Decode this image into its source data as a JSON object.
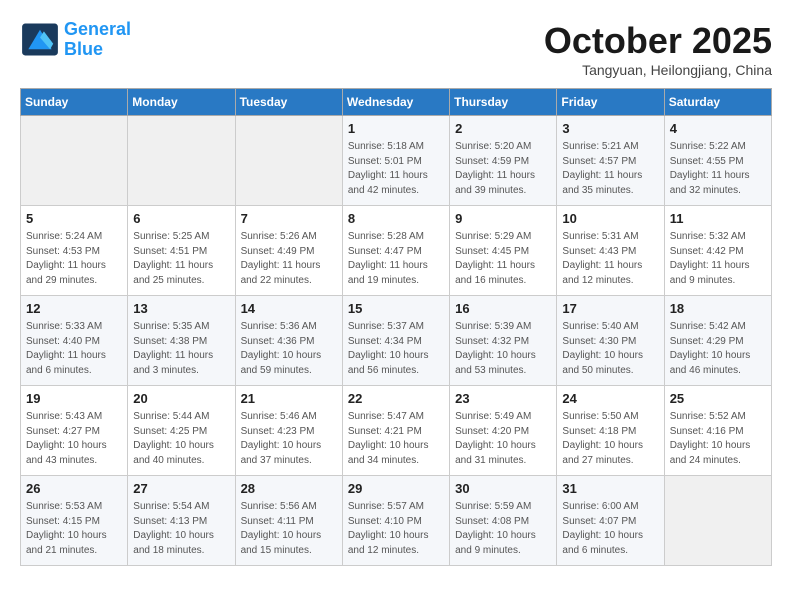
{
  "header": {
    "logo_line1": "General",
    "logo_line2": "Blue",
    "month_title": "October 2025",
    "location": "Tangyuan, Heilongjiang, China"
  },
  "weekdays": [
    "Sunday",
    "Monday",
    "Tuesday",
    "Wednesday",
    "Thursday",
    "Friday",
    "Saturday"
  ],
  "weeks": [
    [
      {
        "day": "",
        "info": ""
      },
      {
        "day": "",
        "info": ""
      },
      {
        "day": "",
        "info": ""
      },
      {
        "day": "1",
        "info": "Sunrise: 5:18 AM\nSunset: 5:01 PM\nDaylight: 11 hours\nand 42 minutes."
      },
      {
        "day": "2",
        "info": "Sunrise: 5:20 AM\nSunset: 4:59 PM\nDaylight: 11 hours\nand 39 minutes."
      },
      {
        "day": "3",
        "info": "Sunrise: 5:21 AM\nSunset: 4:57 PM\nDaylight: 11 hours\nand 35 minutes."
      },
      {
        "day": "4",
        "info": "Sunrise: 5:22 AM\nSunset: 4:55 PM\nDaylight: 11 hours\nand 32 minutes."
      }
    ],
    [
      {
        "day": "5",
        "info": "Sunrise: 5:24 AM\nSunset: 4:53 PM\nDaylight: 11 hours\nand 29 minutes."
      },
      {
        "day": "6",
        "info": "Sunrise: 5:25 AM\nSunset: 4:51 PM\nDaylight: 11 hours\nand 25 minutes."
      },
      {
        "day": "7",
        "info": "Sunrise: 5:26 AM\nSunset: 4:49 PM\nDaylight: 11 hours\nand 22 minutes."
      },
      {
        "day": "8",
        "info": "Sunrise: 5:28 AM\nSunset: 4:47 PM\nDaylight: 11 hours\nand 19 minutes."
      },
      {
        "day": "9",
        "info": "Sunrise: 5:29 AM\nSunset: 4:45 PM\nDaylight: 11 hours\nand 16 minutes."
      },
      {
        "day": "10",
        "info": "Sunrise: 5:31 AM\nSunset: 4:43 PM\nDaylight: 11 hours\nand 12 minutes."
      },
      {
        "day": "11",
        "info": "Sunrise: 5:32 AM\nSunset: 4:42 PM\nDaylight: 11 hours\nand 9 minutes."
      }
    ],
    [
      {
        "day": "12",
        "info": "Sunrise: 5:33 AM\nSunset: 4:40 PM\nDaylight: 11 hours\nand 6 minutes."
      },
      {
        "day": "13",
        "info": "Sunrise: 5:35 AM\nSunset: 4:38 PM\nDaylight: 11 hours\nand 3 minutes."
      },
      {
        "day": "14",
        "info": "Sunrise: 5:36 AM\nSunset: 4:36 PM\nDaylight: 10 hours\nand 59 minutes."
      },
      {
        "day": "15",
        "info": "Sunrise: 5:37 AM\nSunset: 4:34 PM\nDaylight: 10 hours\nand 56 minutes."
      },
      {
        "day": "16",
        "info": "Sunrise: 5:39 AM\nSunset: 4:32 PM\nDaylight: 10 hours\nand 53 minutes."
      },
      {
        "day": "17",
        "info": "Sunrise: 5:40 AM\nSunset: 4:30 PM\nDaylight: 10 hours\nand 50 minutes."
      },
      {
        "day": "18",
        "info": "Sunrise: 5:42 AM\nSunset: 4:29 PM\nDaylight: 10 hours\nand 46 minutes."
      }
    ],
    [
      {
        "day": "19",
        "info": "Sunrise: 5:43 AM\nSunset: 4:27 PM\nDaylight: 10 hours\nand 43 minutes."
      },
      {
        "day": "20",
        "info": "Sunrise: 5:44 AM\nSunset: 4:25 PM\nDaylight: 10 hours\nand 40 minutes."
      },
      {
        "day": "21",
        "info": "Sunrise: 5:46 AM\nSunset: 4:23 PM\nDaylight: 10 hours\nand 37 minutes."
      },
      {
        "day": "22",
        "info": "Sunrise: 5:47 AM\nSunset: 4:21 PM\nDaylight: 10 hours\nand 34 minutes."
      },
      {
        "day": "23",
        "info": "Sunrise: 5:49 AM\nSunset: 4:20 PM\nDaylight: 10 hours\nand 31 minutes."
      },
      {
        "day": "24",
        "info": "Sunrise: 5:50 AM\nSunset: 4:18 PM\nDaylight: 10 hours\nand 27 minutes."
      },
      {
        "day": "25",
        "info": "Sunrise: 5:52 AM\nSunset: 4:16 PM\nDaylight: 10 hours\nand 24 minutes."
      }
    ],
    [
      {
        "day": "26",
        "info": "Sunrise: 5:53 AM\nSunset: 4:15 PM\nDaylight: 10 hours\nand 21 minutes."
      },
      {
        "day": "27",
        "info": "Sunrise: 5:54 AM\nSunset: 4:13 PM\nDaylight: 10 hours\nand 18 minutes."
      },
      {
        "day": "28",
        "info": "Sunrise: 5:56 AM\nSunset: 4:11 PM\nDaylight: 10 hours\nand 15 minutes."
      },
      {
        "day": "29",
        "info": "Sunrise: 5:57 AM\nSunset: 4:10 PM\nDaylight: 10 hours\nand 12 minutes."
      },
      {
        "day": "30",
        "info": "Sunrise: 5:59 AM\nSunset: 4:08 PM\nDaylight: 10 hours\nand 9 minutes."
      },
      {
        "day": "31",
        "info": "Sunrise: 6:00 AM\nSunset: 4:07 PM\nDaylight: 10 hours\nand 6 minutes."
      },
      {
        "day": "",
        "info": ""
      }
    ]
  ]
}
